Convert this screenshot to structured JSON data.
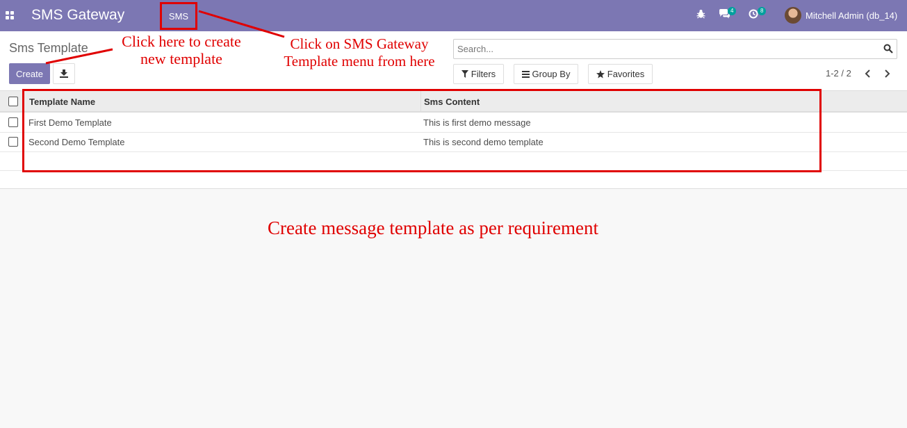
{
  "topbar": {
    "app_name": "SMS Gateway",
    "menu_item": "SMS",
    "chat_badge": "4",
    "activity_badge": "8",
    "user_name": "Mitchell Admin (db_14)"
  },
  "control_panel": {
    "title": "Sms Template",
    "create_label": "Create",
    "search_placeholder": "Search...",
    "filters_label": "Filters",
    "group_by_label": "Group By",
    "favorites_label": "Favorites",
    "pager_text": "1-2 / 2"
  },
  "table": {
    "columns": [
      "Template Name",
      "Sms Content"
    ],
    "rows": [
      {
        "name": "First Demo Template",
        "content": "This is first demo message"
      },
      {
        "name": "Second Demo Template",
        "content": "This is second demo template"
      }
    ]
  },
  "annotations": {
    "create_hint_1": "Click here to create",
    "create_hint_2": "new template",
    "menu_hint_1": "Click on SMS Gateway",
    "menu_hint_2": "Template menu from here",
    "bottom_note": "Create message template as per requirement"
  },
  "colors": {
    "brand": "#7c77b3",
    "annotation": "#e00000",
    "badge": "#00a09d"
  }
}
